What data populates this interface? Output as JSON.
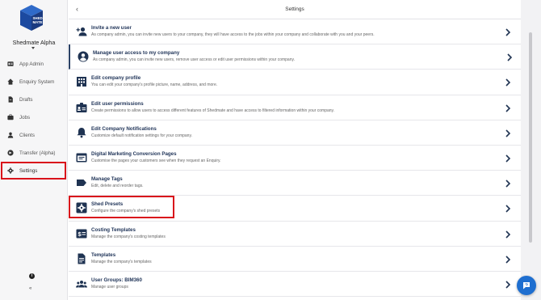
{
  "sidebar": {
    "logo_text": "SHEDMATE",
    "company_name": "Shedmate Alpha",
    "items": [
      {
        "label": "App Admin",
        "icon": "id-card-icon"
      },
      {
        "label": "Enquiry System",
        "icon": "home-icon"
      },
      {
        "label": "Drafts",
        "icon": "draft-icon"
      },
      {
        "label": "Jobs",
        "icon": "briefcase-icon"
      },
      {
        "label": "Clients",
        "icon": "person-icon"
      },
      {
        "label": "Transfer (Alpha)",
        "icon": "transfer-icon"
      },
      {
        "label": "Settings",
        "icon": "gear-icon",
        "active": true
      }
    ],
    "info_glyph": "i",
    "collapse_glyph": "«"
  },
  "header": {
    "back_glyph": "‹",
    "title": "Settings"
  },
  "settings": [
    {
      "title": "Invite a new user",
      "desc": "As company admin, you can invite new users to your company, they will have access to the jobs within your company and collaborate with you and your peers.",
      "icon": "add-user-icon"
    },
    {
      "title": "Manage user access to my company",
      "desc": "As company admin, you can invite new users, remove user access or edit user permissions within your company.",
      "icon": "account-circle-icon",
      "selected": true
    },
    {
      "title": "Edit company profile",
      "desc": "You can edit your company's profile picture, name, address, and more.",
      "icon": "company-building-icon"
    },
    {
      "title": "Edit user permissions",
      "desc": "Create permissions to allow users to access different features of Shedmate and have access to filtered information within your company.",
      "icon": "badge-icon"
    },
    {
      "title": "Edit Company Notifications",
      "desc": "Customize default notification settings for your company.",
      "icon": "bell-icon"
    },
    {
      "title": "Digital Marketing Conversion Pages",
      "desc": "Customise the pages your customers see when they request an Enquiry.",
      "icon": "web-page-icon"
    },
    {
      "title": "Manage Tags",
      "desc": "Edit, delete and reorder tags.",
      "icon": "tag-icon"
    },
    {
      "title": "Shed Presets",
      "desc": "Configure the company's shed presets",
      "icon": "preset-gear-icon"
    },
    {
      "title": "Costing Templates",
      "desc": "Manage the company's costing templates",
      "icon": "costing-icon"
    },
    {
      "title": "Templates",
      "desc": "Manage the company's templates",
      "icon": "document-icon"
    },
    {
      "title": "User Groups: BIM360",
      "desc": "Manage user groups",
      "icon": "user-group-icon"
    }
  ],
  "colors": {
    "accent": "#22365a",
    "highlight_red": "#d9121b",
    "help_button": "#1f6fd0"
  }
}
